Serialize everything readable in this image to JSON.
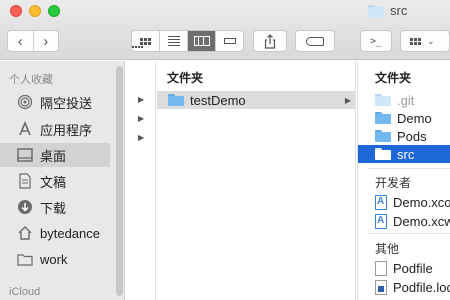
{
  "window": {
    "title": "src",
    "title_icon": "folder-icon"
  },
  "toolbar": {
    "back_glyph": "‹",
    "forward_glyph": "›",
    "view_modes": [
      "icon",
      "list",
      "column",
      "gallery"
    ],
    "active_view": "column",
    "terminal_label": ">_"
  },
  "sidebar": {
    "favorites_header": "个人收藏",
    "items": [
      {
        "label": "隔空投送",
        "icon": "airdrop-icon"
      },
      {
        "label": "应用程序",
        "icon": "applications-icon"
      },
      {
        "label": "桌面",
        "icon": "desktop-icon",
        "selected": true
      },
      {
        "label": "文稿",
        "icon": "documents-icon"
      },
      {
        "label": "下载",
        "icon": "downloads-icon"
      },
      {
        "label": "bytedance",
        "icon": "home-icon"
      },
      {
        "label": "work",
        "icon": "folder-icon"
      }
    ],
    "icloud_header": "iCloud"
  },
  "column2": {
    "header": "文件夹",
    "items": [
      {
        "label": "testDemo",
        "selected": true
      }
    ]
  },
  "column3": {
    "folders_header": "文件夹",
    "folders": [
      {
        "label": ".git",
        "dimmed": true
      },
      {
        "label": "Demo"
      },
      {
        "label": "Pods"
      },
      {
        "label": "src",
        "selected": true
      }
    ],
    "developer_header": "开发者",
    "developer_items": [
      {
        "label": "Demo.xco"
      },
      {
        "label": "Demo.xcw"
      }
    ],
    "other_header": "其他",
    "other_items": [
      {
        "label": "Podfile"
      },
      {
        "label": "Podfile.loc"
      }
    ]
  }
}
